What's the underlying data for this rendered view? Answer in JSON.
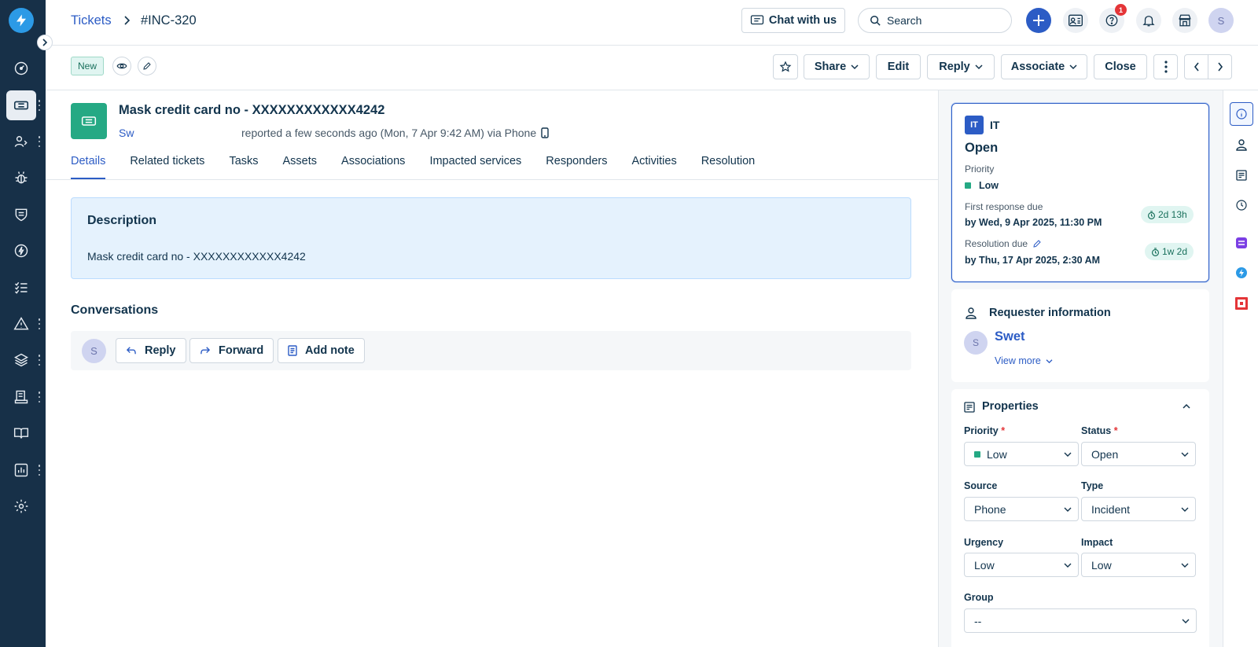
{
  "topbar": {
    "breadcrumb_link": "Tickets",
    "ticket_id": "#INC-320",
    "chat_label": "Chat with us",
    "search_placeholder": "Search",
    "help_badge": "1",
    "avatar_initial": "S"
  },
  "subheader": {
    "status_tag": "New",
    "share_label": "Share",
    "edit_label": "Edit",
    "reply_label": "Reply",
    "associate_label": "Associate",
    "close_label": "Close"
  },
  "ticket": {
    "title": "Mask credit card no - XXXXXXXXXXXX4242",
    "reporter": "Sw",
    "meta": "reported a few seconds ago (Mon, 7 Apr 9:42 AM) via Phone",
    "tabs": [
      "Details",
      "Related tickets",
      "Tasks",
      "Assets",
      "Associations",
      "Impacted services",
      "Responders",
      "Activities",
      "Resolution"
    ],
    "active_tab": "Details"
  },
  "description": {
    "heading": "Description",
    "text": "Mask credit card no - XXXXXXXXXXXX4242"
  },
  "conversations": {
    "heading": "Conversations",
    "avatar_initial": "S",
    "reply_label": "Reply",
    "forward_label": "Forward",
    "add_note_label": "Add note"
  },
  "status_card": {
    "group_badge": "IT",
    "group_name": "IT",
    "status": "Open",
    "priority_label": "Priority",
    "priority_value": "Low",
    "first_response_label": "First response due",
    "first_response_value": "by Wed, 9 Apr 2025, 11:30 PM",
    "first_response_pill": "2d 13h",
    "resolution_label": "Resolution due",
    "resolution_value": "by Thu, 17 Apr 2025, 2:30 AM",
    "resolution_pill": "1w 2d"
  },
  "requester": {
    "heading": "Requester information",
    "avatar_initial": "S",
    "name": "Swet",
    "view_more": "View more"
  },
  "properties": {
    "heading": "Properties",
    "priority_label": "Priority",
    "priority_value": "Low",
    "status_label": "Status",
    "status_value": "Open",
    "source_label": "Source",
    "source_value": "Phone",
    "type_label": "Type",
    "type_value": "Incident",
    "urgency_label": "Urgency",
    "urgency_value": "Low",
    "impact_label": "Impact",
    "impact_value": "Low",
    "group_label": "Group",
    "group_value": "--",
    "required_mark": "*"
  },
  "colors": {
    "nav_bg": "#173048",
    "accent": "#2c5cc5",
    "ticket_green": "#25a984",
    "description_bg": "#e5f2fd",
    "badge_red": "#e43538"
  }
}
